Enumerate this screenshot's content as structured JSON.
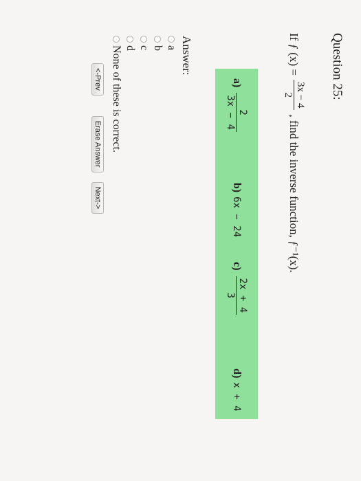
{
  "question": {
    "title": "Question 25:",
    "stem_prefix": "If ƒ (x) =",
    "stem_num": "3x − 4",
    "stem_den": "2",
    "stem_suffix": ", find the inverse function, ƒ⁻¹(x)."
  },
  "choices": [
    {
      "label": "a)",
      "num": "2",
      "den": "3x − 4"
    },
    {
      "label": "b)",
      "text": "6x − 24"
    },
    {
      "label": "c)",
      "num": "2x + 4",
      "den": "3"
    },
    {
      "label": "d)",
      "text": "x + 4"
    }
  ],
  "answer": {
    "label": "Answer:",
    "options": [
      "a",
      "b",
      "c",
      "d",
      "None of these is correct."
    ]
  },
  "buttons": {
    "prev": "<-Prev",
    "erase": "Erase Answer",
    "next": "Next->"
  },
  "colors": {
    "choices_highlight": "#8fe09a"
  }
}
